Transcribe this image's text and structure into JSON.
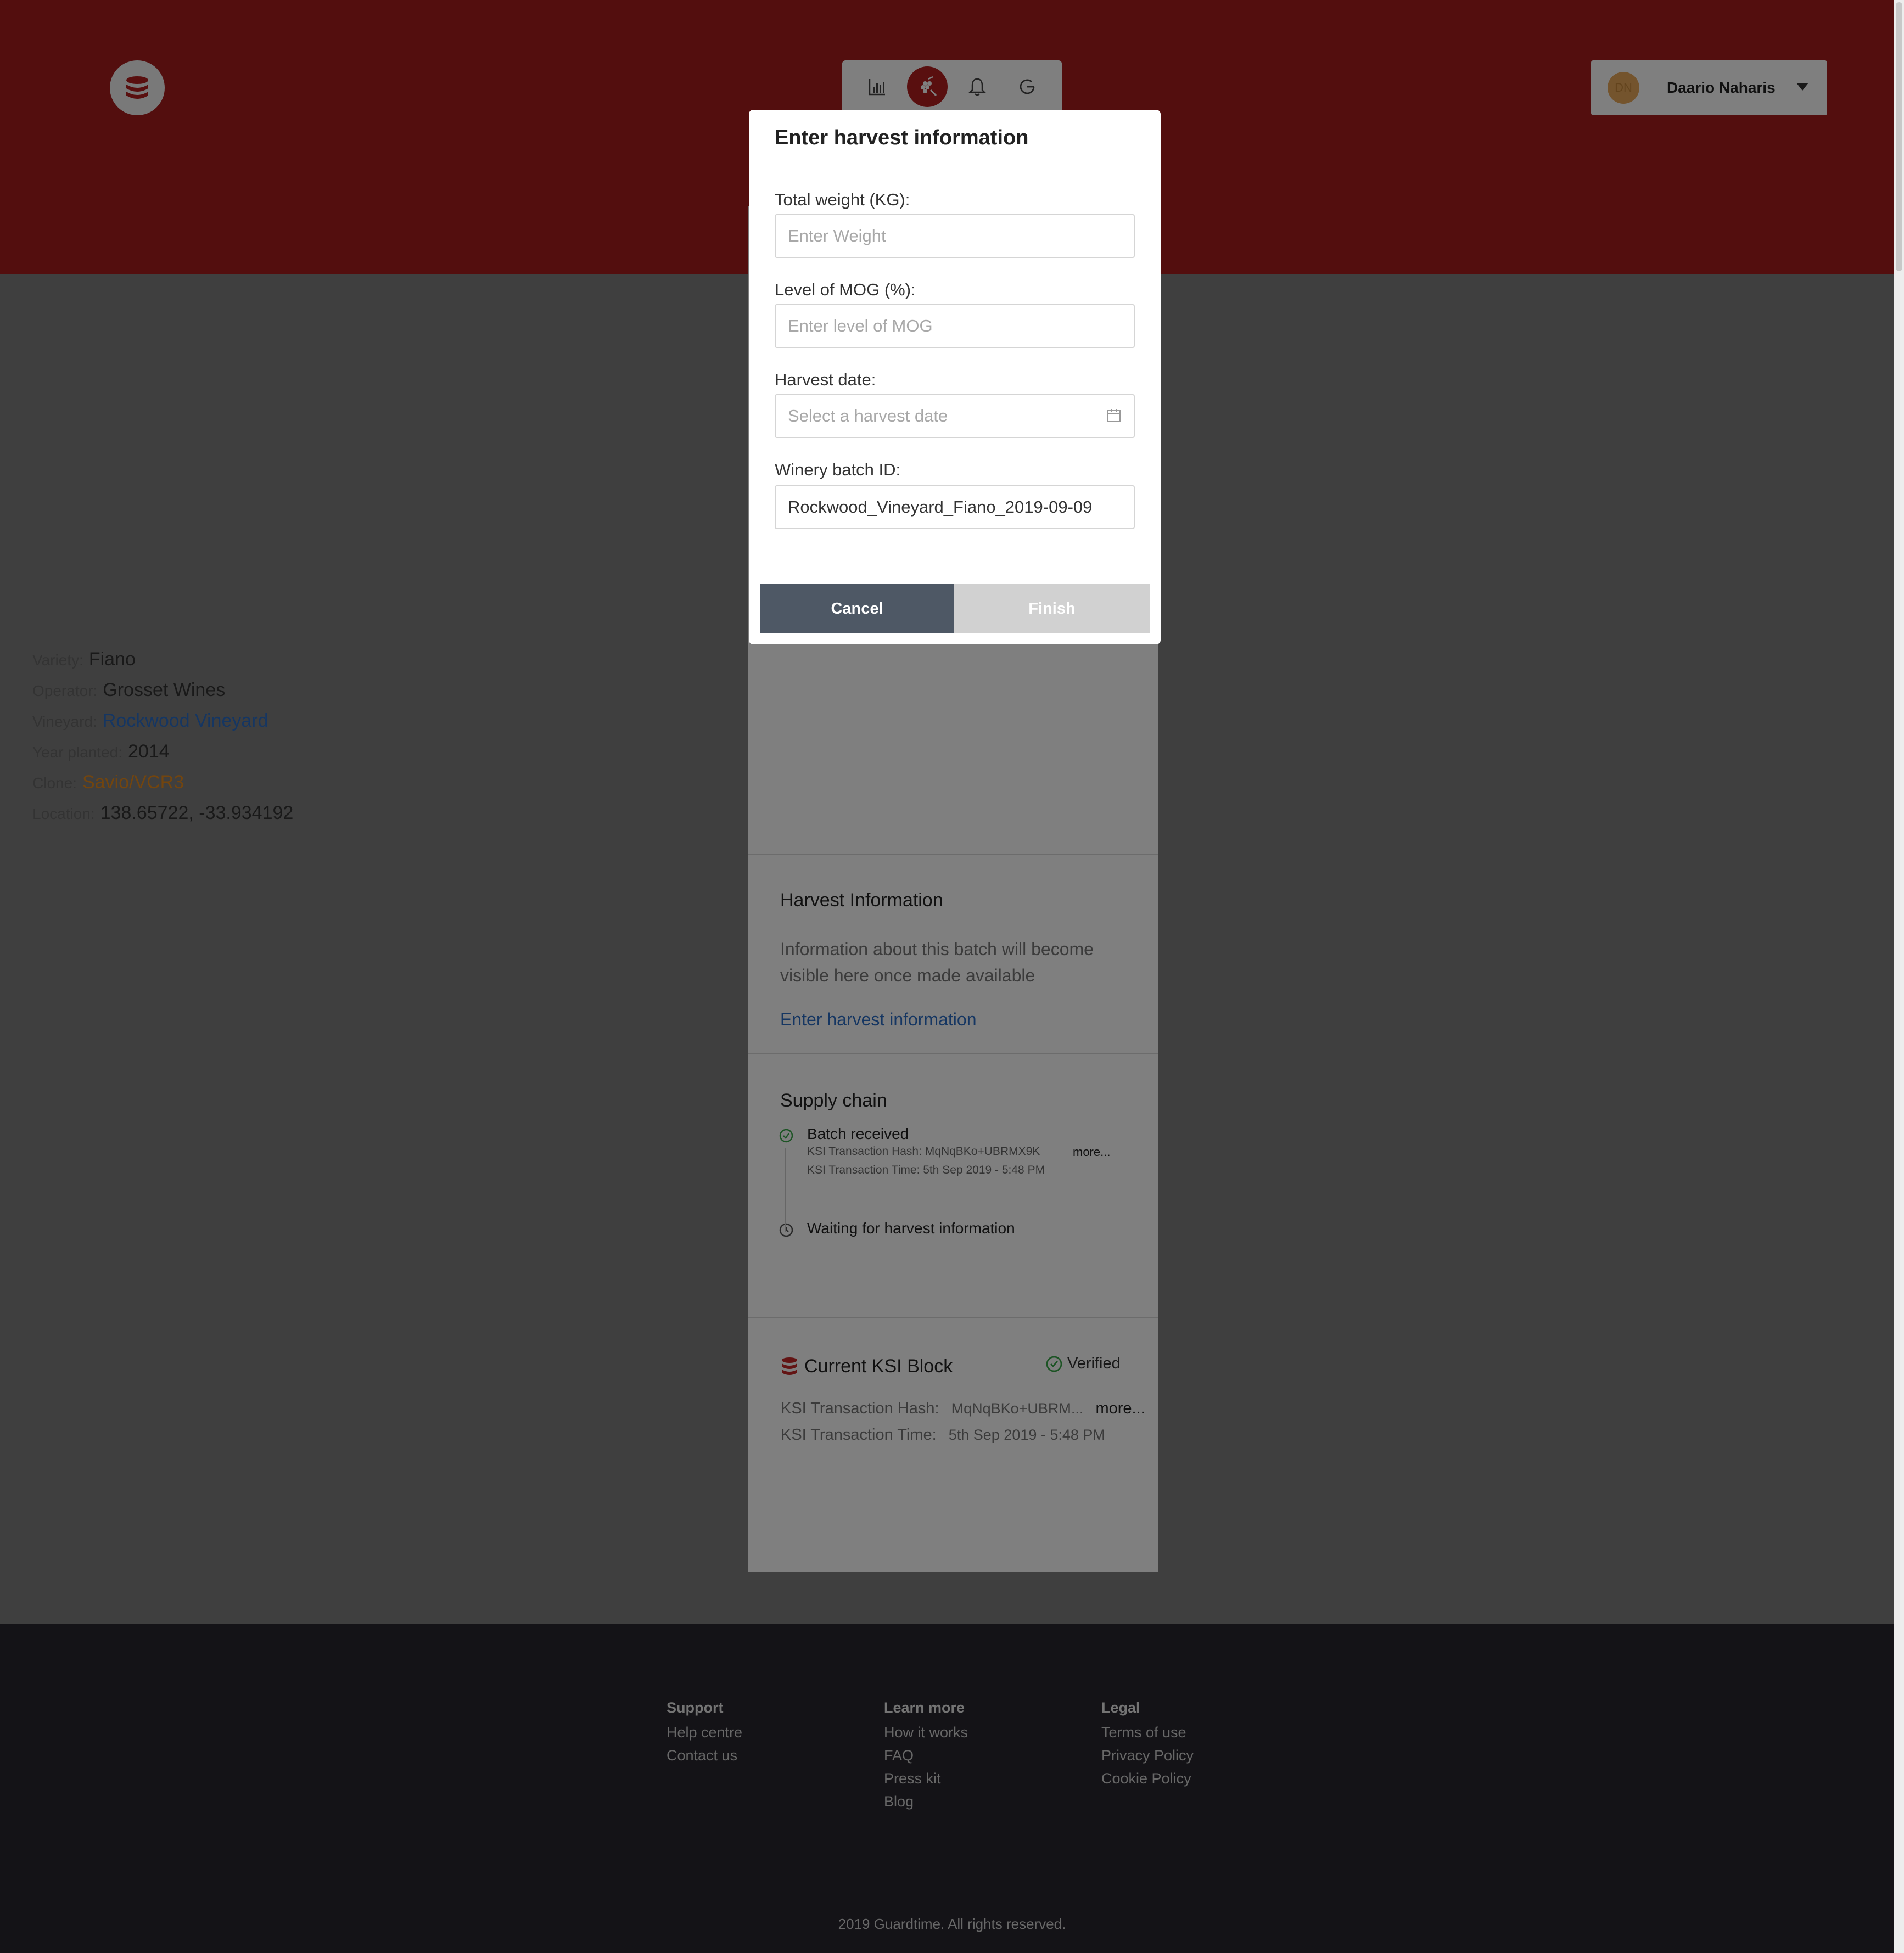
{
  "colors": {
    "brand": "#a61c1c",
    "link": "#2b6cc4",
    "clone": "#e68a1c",
    "verified": "#3aa84a",
    "footer": "#28262e"
  },
  "header": {
    "nav": [
      {
        "icon": "bar-chart-icon"
      },
      {
        "icon": "grape-harvest-icon",
        "active": true
      },
      {
        "icon": "bell-icon"
      },
      {
        "icon": "refresh-icon"
      }
    ],
    "user": {
      "initials": "DN",
      "name": "Daario Naharis"
    }
  },
  "batch": {
    "rows": [
      {
        "key": "Variety:",
        "value": "Fiano"
      },
      {
        "key": "Operator:",
        "value": "Grosset Wines"
      },
      {
        "key": "Vineyard:",
        "value": "Rockwood Vineyard"
      },
      {
        "key": "Year planted:",
        "value": "2014"
      },
      {
        "key": "Clone:",
        "value": "Savio/VCR3"
      },
      {
        "key": "Location:",
        "value": "138.65722, -33.934192"
      }
    ]
  },
  "harvest": {
    "title": "Harvest Information",
    "text": "Information about this batch will become visible here once made available",
    "link": "Enter harvest information"
  },
  "supply_chain": {
    "title": "Supply chain",
    "received": "Batch received",
    "hash": "KSI Transaction Hash: MqNqBKo+UBRMX9K",
    "more": "more...",
    "time": "KSI Transaction Time: 5th Sep 2019 - 5:48 PM",
    "waiting": "Waiting for harvest information"
  },
  "ksi_block": {
    "title": "Current KSI Block",
    "verified": "Verified",
    "hash_label": "KSI Transaction Hash:",
    "hash_value": "MqNqBKo+UBRM...",
    "more": "more...",
    "time_label": "KSI Transaction Time:",
    "time_value": "5th Sep 2019 - 5:48 PM"
  },
  "footer": {
    "support": {
      "title": "Support",
      "links": [
        "Help centre",
        "Contact us"
      ]
    },
    "learn": {
      "title": "Learn more",
      "links": [
        "How it works",
        "FAQ",
        "Press kit",
        "Blog"
      ]
    },
    "legal": {
      "title": "Legal",
      "links": [
        "Terms of use",
        "Privacy Policy",
        "Cookie Policy"
      ]
    },
    "copyright": "2019 Guardtime. All rights reserved."
  },
  "modal": {
    "title": "Enter harvest information",
    "weight": {
      "label": "Total weight (KG):",
      "placeholder": "Enter Weight",
      "value": ""
    },
    "mog": {
      "label": "Level of MOG (%):",
      "placeholder": "Enter level of MOG",
      "value": ""
    },
    "date": {
      "label": "Harvest date:",
      "placeholder": "Select a harvest date",
      "value": ""
    },
    "batch_id": {
      "label": "Winery batch ID:",
      "value": "Rockwood_Vineyard_Fiano_2019-09-09"
    },
    "cancel": "Cancel",
    "finish": "Finish"
  }
}
